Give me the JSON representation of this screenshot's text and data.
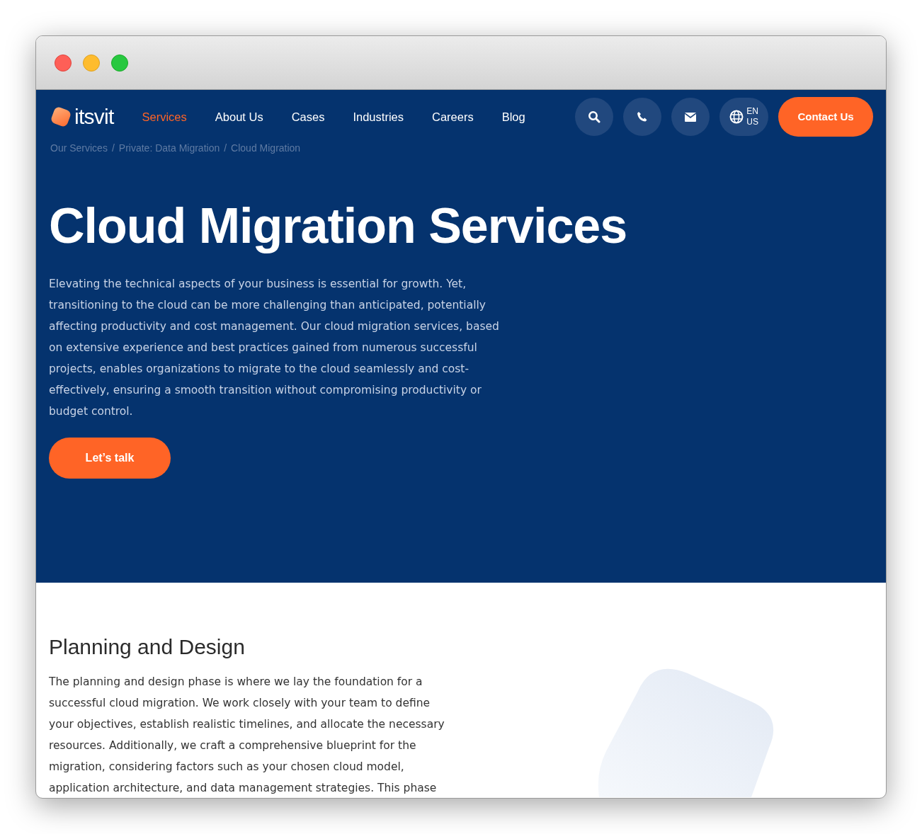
{
  "logo": {
    "text": "itsvit"
  },
  "nav": [
    {
      "label": "Services",
      "selected": true
    },
    {
      "label": "About Us",
      "selected": false
    },
    {
      "label": "Cases",
      "selected": false
    },
    {
      "label": "Industries",
      "selected": false
    },
    {
      "label": "Careers",
      "selected": false
    },
    {
      "label": "Blog",
      "selected": false
    }
  ],
  "language": {
    "line_1": "EN",
    "line_2": "US"
  },
  "contact_button": "Contact Us",
  "breadcrumbs": [
    "Our Services",
    "Private: Data Migration",
    "Cloud Migration"
  ],
  "breadcrumb_separator": "/",
  "hero": {
    "title": "Cloud Migration Services",
    "text": "Elevating the technical aspects of your business is essential for growth. Yet, transitioning to the cloud can be more challenging than anticipated, potentially affecting productivity and cost management. Our cloud migration services, based on extensive experience and best practices gained from numerous successful projects, enables organizations to migrate to the cloud seamlessly and cost-effectively, ensuring a smooth transition without compromising productivity or budget control.",
    "button": "Let’s talk"
  },
  "section": {
    "title": "Planning and Design",
    "text": "The planning and design phase is where we lay the foundation for a successful cloud migration. We work closely with your team to define your objectives, establish realistic timelines, and allocate the necessary resources. Additionally, we craft a comprehensive blueprint for the migration, considering factors such as your chosen cloud model, application architecture, and data management strategies. This phase"
  }
}
